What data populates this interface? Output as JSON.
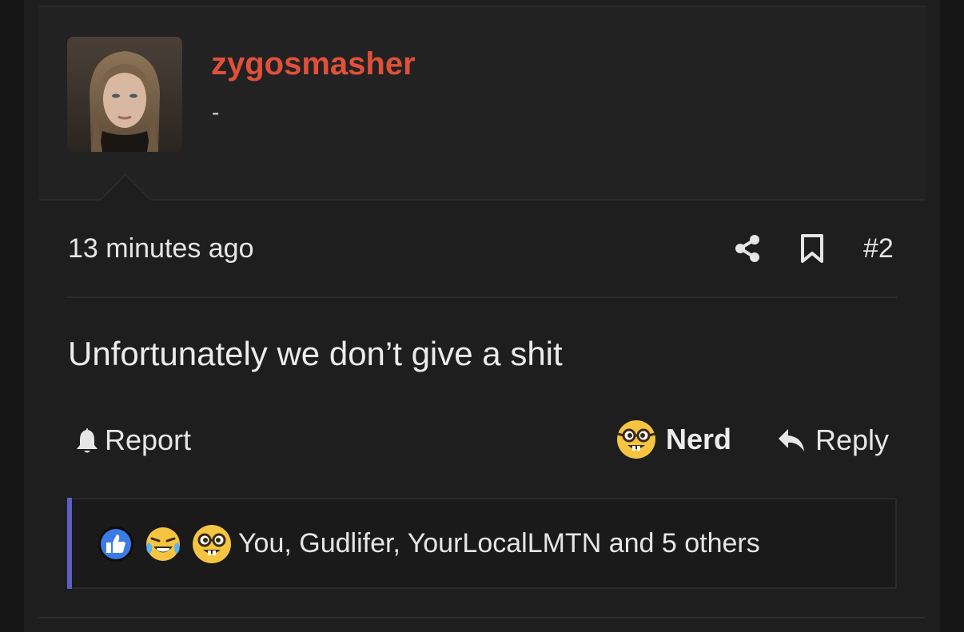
{
  "user": {
    "username": "zygosmasher",
    "title": "-",
    "avatar_icon": "user-avatar-photo"
  },
  "post": {
    "timestamp": "13 minutes ago",
    "number": "#2",
    "body": "Unfortunately we don’t give a shit"
  },
  "actions": {
    "report_label": "Report",
    "nerd_label": "Nerd",
    "reply_label": "Reply"
  },
  "reactions": {
    "icons": [
      "like-icon",
      "laughing-crying-icon",
      "nerd-face-icon"
    ],
    "summary": "You, Gudlifer, YourLocalLMTN and 5 others"
  },
  "colors": {
    "username": "#e0503a",
    "accent": "#5b5fc4",
    "background": "#1e1e1e"
  }
}
